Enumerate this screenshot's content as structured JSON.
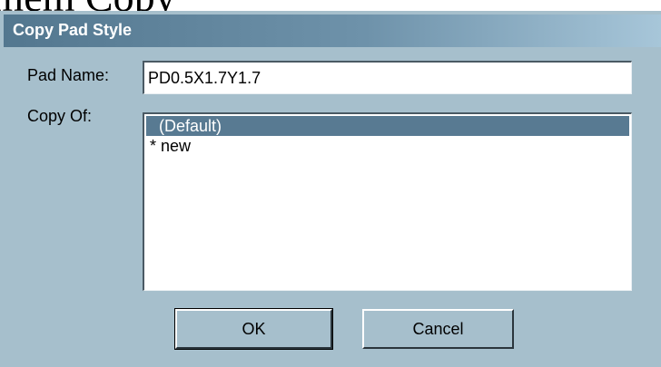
{
  "background": {
    "text": "amem Copy"
  },
  "window": {
    "title": "Copy Pad Style"
  },
  "form": {
    "pad_name_label": "Pad Name:",
    "pad_name_value": "PD0.5X1.7Y1.7",
    "copy_of_label": "Copy Of:",
    "copy_of_items": [
      {
        "label": "(Default)",
        "selected": true
      },
      {
        "label": "* new",
        "selected": false
      }
    ]
  },
  "buttons": {
    "ok": "OK",
    "cancel": "Cancel"
  },
  "colors": {
    "dialog_bg": "#a6bfcc",
    "selection": "#587a92",
    "title_text": "#ffffff"
  }
}
